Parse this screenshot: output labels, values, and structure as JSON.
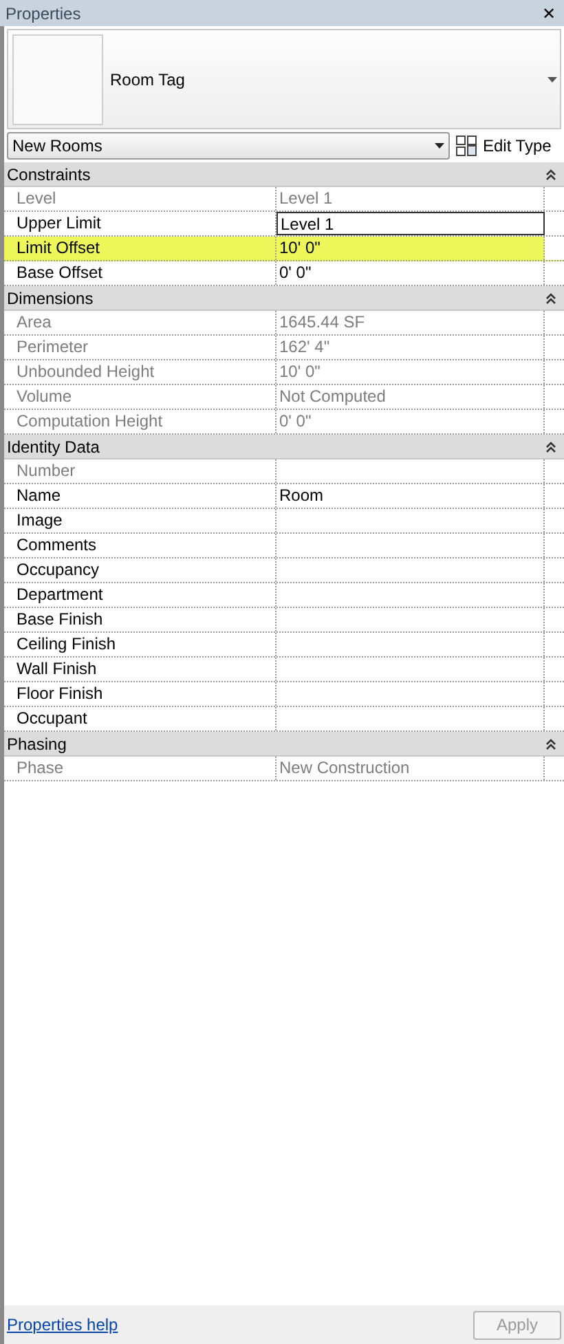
{
  "window": {
    "title": "Properties",
    "close": "✕"
  },
  "type_selector": {
    "label": "Room Tag"
  },
  "instance_filter": {
    "value": "New Rooms"
  },
  "edit_type_button": {
    "label": "Edit Type"
  },
  "sections": [
    {
      "title": "Constraints",
      "expanded": true,
      "rows": [
        {
          "label": "Level",
          "value": "Level 1",
          "disabled": true,
          "highlighted": false,
          "editing": false
        },
        {
          "label": "Upper Limit",
          "value": "Level 1",
          "disabled": false,
          "highlighted": false,
          "editing": true
        },
        {
          "label": "Limit Offset",
          "value": "10'  0\"",
          "disabled": false,
          "highlighted": true,
          "editing": false
        },
        {
          "label": "Base Offset",
          "value": "0'  0\"",
          "disabled": false,
          "highlighted": false,
          "editing": false
        }
      ]
    },
    {
      "title": "Dimensions",
      "expanded": true,
      "rows": [
        {
          "label": "Area",
          "value": "1645.44 SF",
          "disabled": true,
          "highlighted": false,
          "editing": false
        },
        {
          "label": "Perimeter",
          "value": "162'  4\"",
          "disabled": true,
          "highlighted": false,
          "editing": false
        },
        {
          "label": "Unbounded Height",
          "value": "10'  0\"",
          "disabled": true,
          "highlighted": false,
          "editing": false
        },
        {
          "label": "Volume",
          "value": "Not Computed",
          "disabled": true,
          "highlighted": false,
          "editing": false
        },
        {
          "label": "Computation Height",
          "value": "0'  0\"",
          "disabled": true,
          "highlighted": false,
          "editing": false
        }
      ]
    },
    {
      "title": "Identity Data",
      "expanded": true,
      "rows": [
        {
          "label": "Number",
          "disabled": true,
          "highlighted": false,
          "editing": false
        },
        {
          "label": "Name",
          "value": "Room",
          "disabled": false,
          "highlighted": false,
          "editing": false
        },
        {
          "label": "Image",
          "disabled": false,
          "highlighted": false,
          "editing": false
        },
        {
          "label": "Comments",
          "disabled": false,
          "highlighted": false,
          "editing": false
        },
        {
          "label": "Occupancy",
          "disabled": false,
          "highlighted": false,
          "editing": false
        },
        {
          "label": "Department",
          "disabled": false,
          "highlighted": false,
          "editing": false
        },
        {
          "label": "Base Finish",
          "disabled": false,
          "highlighted": false,
          "editing": false
        },
        {
          "label": "Ceiling Finish",
          "disabled": false,
          "highlighted": false,
          "editing": false
        },
        {
          "label": "Wall Finish",
          "disabled": false,
          "highlighted": false,
          "editing": false
        },
        {
          "label": "Floor Finish",
          "disabled": false,
          "highlighted": false,
          "editing": false
        },
        {
          "label": "Occupant",
          "disabled": false,
          "highlighted": false,
          "editing": false
        }
      ]
    },
    {
      "title": "Phasing",
      "expanded": true,
      "rows": [
        {
          "label": "Phase",
          "value": "New Construction",
          "disabled": true,
          "highlighted": false,
          "editing": false
        }
      ]
    }
  ],
  "footer": {
    "help_link": "Properties help",
    "apply_button": {
      "label": "Apply",
      "disabled": true
    }
  }
}
